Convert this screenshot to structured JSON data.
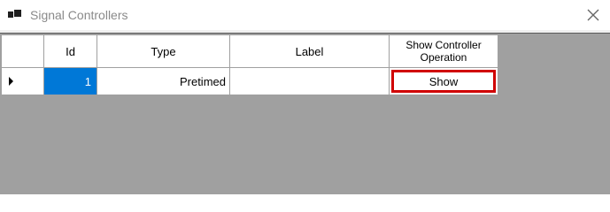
{
  "window": {
    "title": "Signal Controllers",
    "icon": "app-window-icon",
    "close_icon": "close-icon"
  },
  "grid": {
    "columns": [
      "",
      "Id",
      "Type",
      "Label",
      "Show Controller Operation"
    ],
    "rows": [
      {
        "id": "1",
        "type": "Pretimed",
        "label": "",
        "button_label": "Show",
        "selected_cell": "id"
      }
    ]
  },
  "colors": {
    "selection": "#0078d7",
    "button_border": "#d00000",
    "empty_area": "#a0a0a0"
  }
}
